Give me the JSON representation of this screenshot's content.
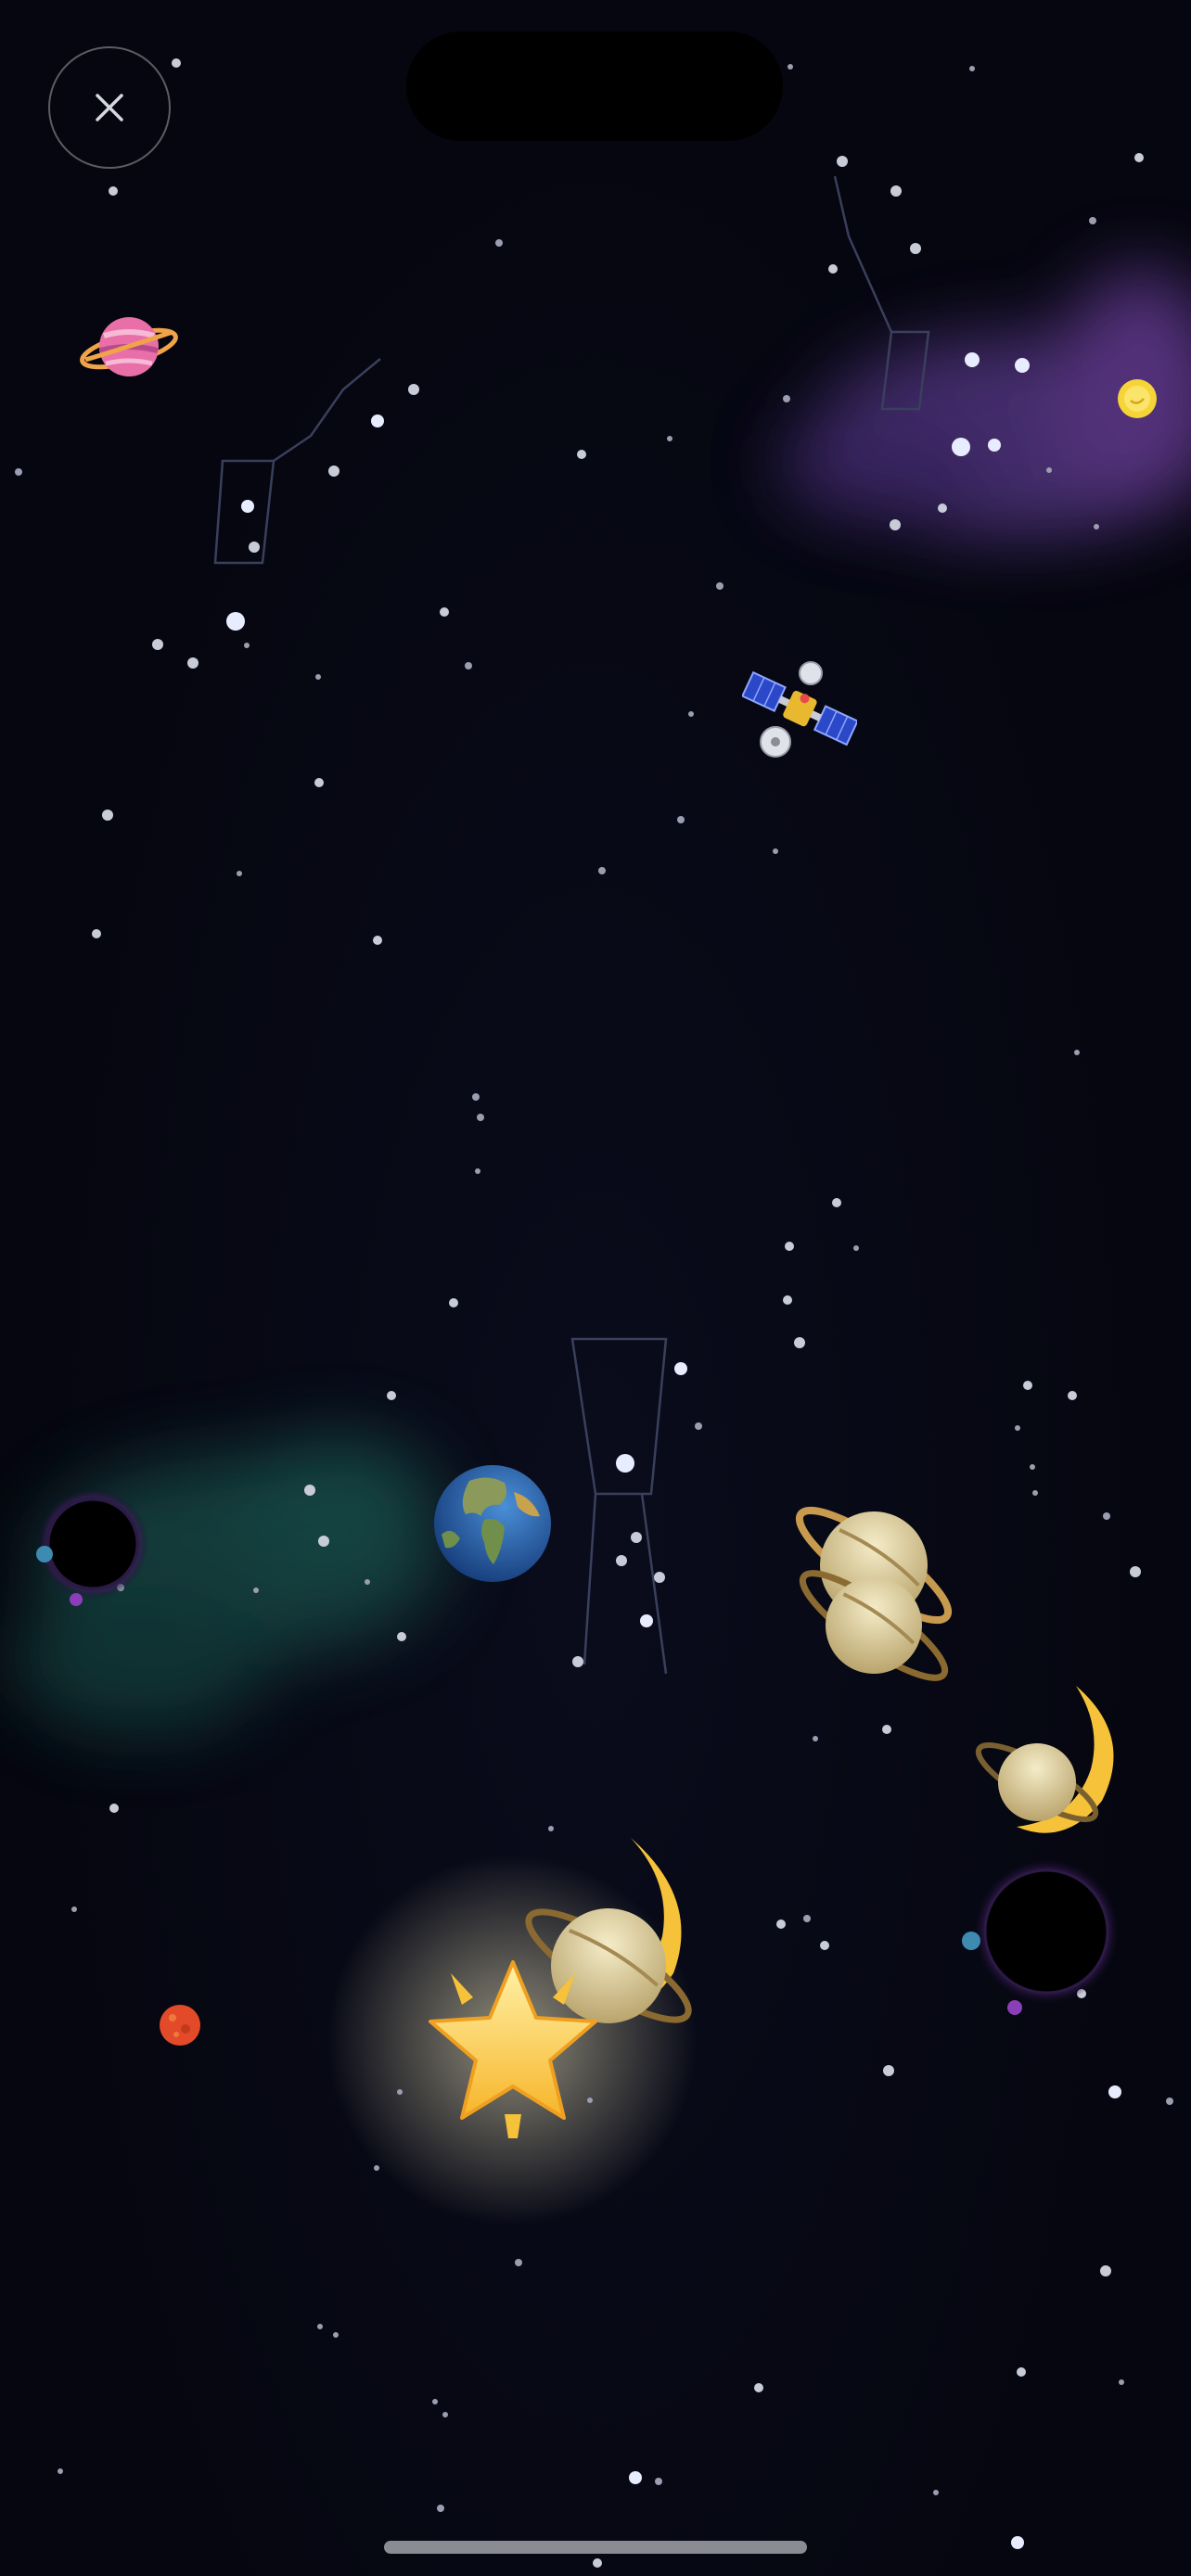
{
  "game": {
    "title": "",
    "controls": {
      "close": {
        "icon": "close-icon"
      }
    },
    "objects": [
      {
        "name": "ringed-planet-pink",
        "icon": "ringed-planet-icon"
      },
      {
        "name": "satellite",
        "icon": "satellite-icon"
      },
      {
        "name": "earth",
        "icon": "earth-globe-icon"
      },
      {
        "name": "saturn",
        "icon": "saturn-icon"
      },
      {
        "name": "saturn-moon-combo-small",
        "icon": "saturn-moon-icon"
      },
      {
        "name": "saturn-moon-combo-large",
        "icon": "saturn-moon-icon"
      },
      {
        "name": "glowing-star",
        "icon": "glowing-star-icon"
      },
      {
        "name": "red-planet",
        "icon": "red-planet-icon"
      },
      {
        "name": "sun-coin",
        "icon": "sun-icon"
      },
      {
        "name": "black-hole-left",
        "icon": "black-hole-icon"
      },
      {
        "name": "black-hole-right",
        "icon": "black-hole-icon"
      }
    ],
    "colors": {
      "background": "#05060f",
      "star": "#e8ecff",
      "constellation": "#3a3f5c",
      "nebula_purple": "#6b3f9a",
      "nebula_teal": "#1f6b5e",
      "gold": "#f5c23a"
    }
  }
}
